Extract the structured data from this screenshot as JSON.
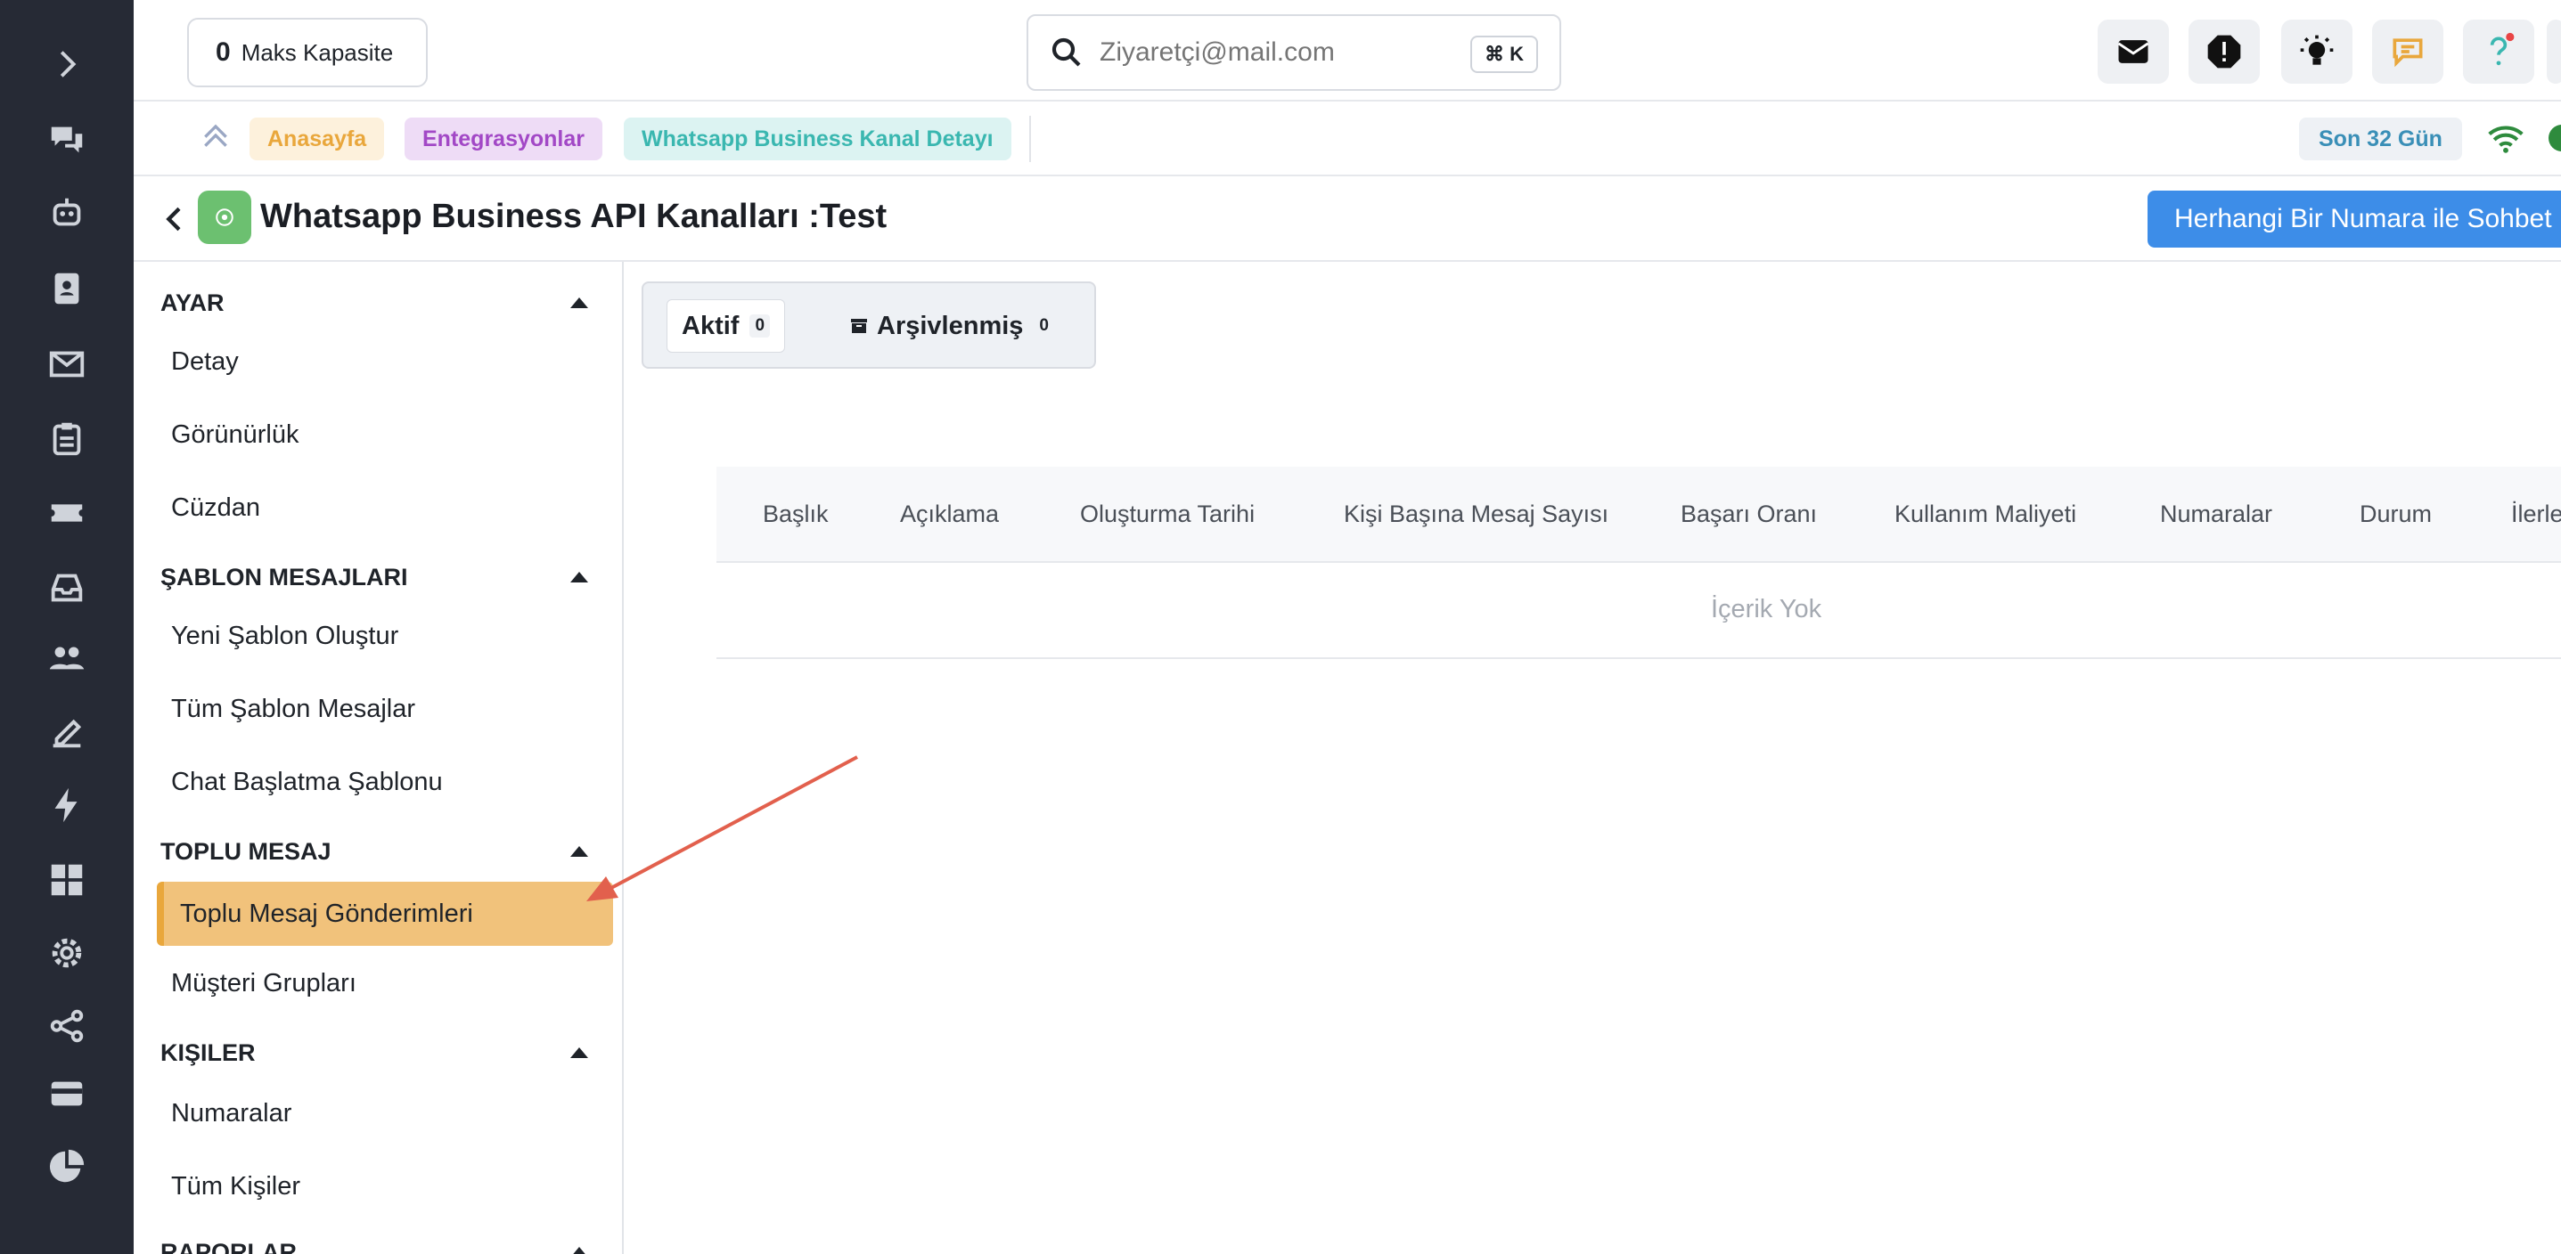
{
  "header": {
    "capacity_value": "0",
    "capacity_label": "Maks Kapasite",
    "search_placeholder": "Ziyaretçi@mail.com",
    "search_shortcut": "⌘ K"
  },
  "breadcrumbs": [
    {
      "label": "Anasayfa",
      "color": "#e9a73c",
      "bg": "#fdf1dc"
    },
    {
      "label": "Entegrasyonlar",
      "color": "#a248c6",
      "bg": "#eedcf6"
    },
    {
      "label": "Whatsapp Business Kanal Detayı",
      "color": "#3ab7b0",
      "bg": "#dcf3f2"
    }
  ],
  "period_label": "Son 32 Gün",
  "page": {
    "title": "Whatsapp Business API Kanalları :Test",
    "action_button": "Herhangi Bir Numara ile Sohbet"
  },
  "sidebar": {
    "sections": [
      {
        "title": "AYAR",
        "items": [
          "Detay",
          "Görünürlük",
          "Cüzdan"
        ]
      },
      {
        "title": "ŞABLON MESAJLARI",
        "items": [
          "Yeni Şablon Oluştur",
          "Tüm Şablon Mesajlar",
          "Chat Başlatma Şablonu"
        ]
      },
      {
        "title": "TOPLU MESAJ",
        "items": [
          "Toplu Mesaj Gönderimleri",
          "Müşteri Grupları"
        ]
      },
      {
        "title": "KIŞILER",
        "items": [
          "Numaralar",
          "Tüm Kişiler"
        ]
      },
      {
        "title": "RAPORLAR",
        "items": []
      }
    ],
    "active_item": "Toplu Mesaj Gönderimleri"
  },
  "tabs": [
    {
      "label": "Aktif",
      "count": "0"
    },
    {
      "label": "Arşivlenmiş",
      "count": "0"
    }
  ],
  "table": {
    "columns": [
      "Başlık",
      "Açıklama",
      "Oluşturma Tarihi",
      "Kişi Başına Mesaj Sayısı",
      "Başarı Oranı",
      "Kullanım Maliyeti",
      "Numaralar",
      "Durum",
      "İlerleme"
    ],
    "empty_text": "İçerik Yok"
  },
  "colors": {
    "rail_bg": "#262a35",
    "accent_active": "#f1c27b",
    "primary_button": "#3d8de8"
  }
}
